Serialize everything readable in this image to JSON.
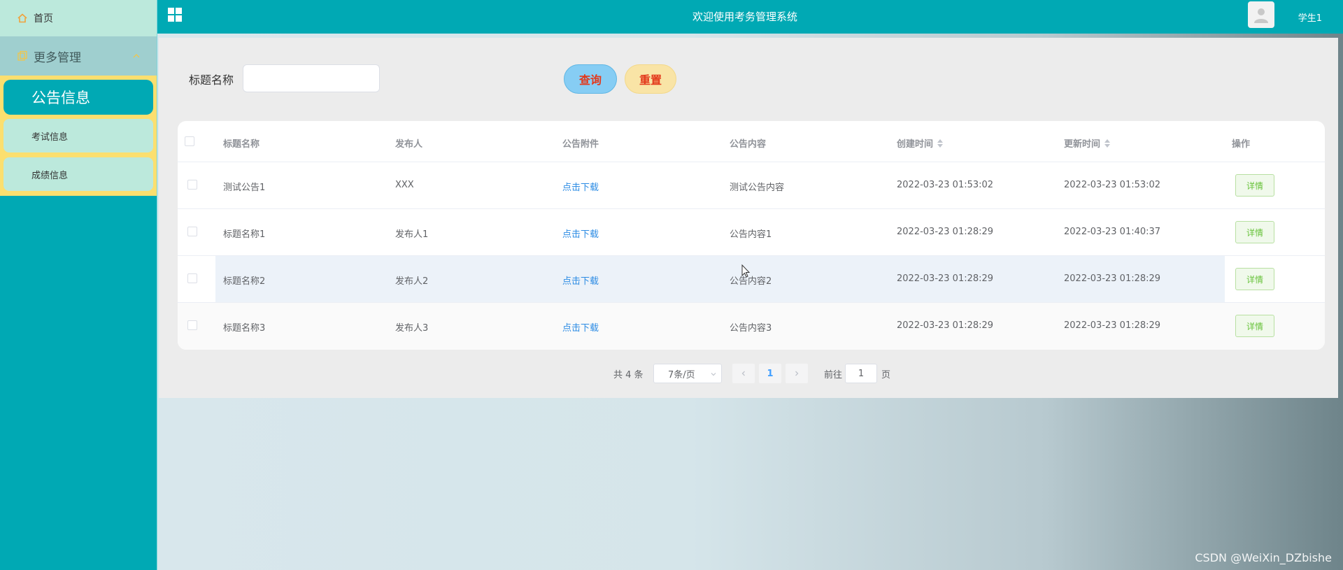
{
  "sidebar": {
    "home": "首页",
    "more": "更多管理",
    "items": [
      "公告信息",
      "考试信息",
      "成绩信息"
    ]
  },
  "header": {
    "title": "欢迎使用考务管理系统",
    "user": "学生1"
  },
  "search": {
    "label": "标题名称",
    "value": "",
    "query": "查询",
    "reset": "重置"
  },
  "table": {
    "columns": [
      "标题名称",
      "发布人",
      "公告附件",
      "公告内容",
      "创建时间",
      "更新时间",
      "操作"
    ],
    "rows": [
      {
        "title": "测试公告1",
        "publisher": "XXX",
        "attachment": "点击下载",
        "content": "测试公告内容",
        "created": "2022-03-23 01:53:02",
        "updated": "2022-03-23 01:53:02",
        "action": "详情"
      },
      {
        "title": "标题名称1",
        "publisher": "发布人1",
        "attachment": "点击下载",
        "content": "公告内容1",
        "created": "2022-03-23 01:28:29",
        "updated": "2022-03-23 01:40:37",
        "action": "详情"
      },
      {
        "title": "标题名称2",
        "publisher": "发布人2",
        "attachment": "点击下载",
        "content": "公告内容2",
        "created": "2022-03-23 01:28:29",
        "updated": "2022-03-23 01:28:29",
        "action": "详情"
      },
      {
        "title": "标题名称3",
        "publisher": "发布人3",
        "attachment": "点击下载",
        "content": "公告内容3",
        "created": "2022-03-23 01:28:29",
        "updated": "2022-03-23 01:28:29",
        "action": "详情"
      }
    ]
  },
  "pagination": {
    "total": "共 4 条",
    "page_size": "7条/页",
    "current": "1",
    "goto_label": "前往",
    "goto_value": "1",
    "page_label": "页"
  },
  "watermark": "CSDN @WeiXin_DZbishe",
  "colors": {
    "primary": "#00a9b4",
    "submenu_bg": "#fbdf6f",
    "menu_light": "#bce9dc",
    "query_btn": "#86cdf4",
    "reset_btn": "#f9e4a6",
    "button_text": "#e3381b",
    "link": "#2d8ce4",
    "detail_green": "#67c23a"
  },
  "icons": {
    "home": "home-icon",
    "more": "copy-icon",
    "expand": "chevron-up-icon",
    "grid": "grid-icon",
    "avatar": "user-avatar-icon",
    "sort": "sort-icon",
    "prev": "chevron-left-icon",
    "next": "chevron-right-icon"
  }
}
